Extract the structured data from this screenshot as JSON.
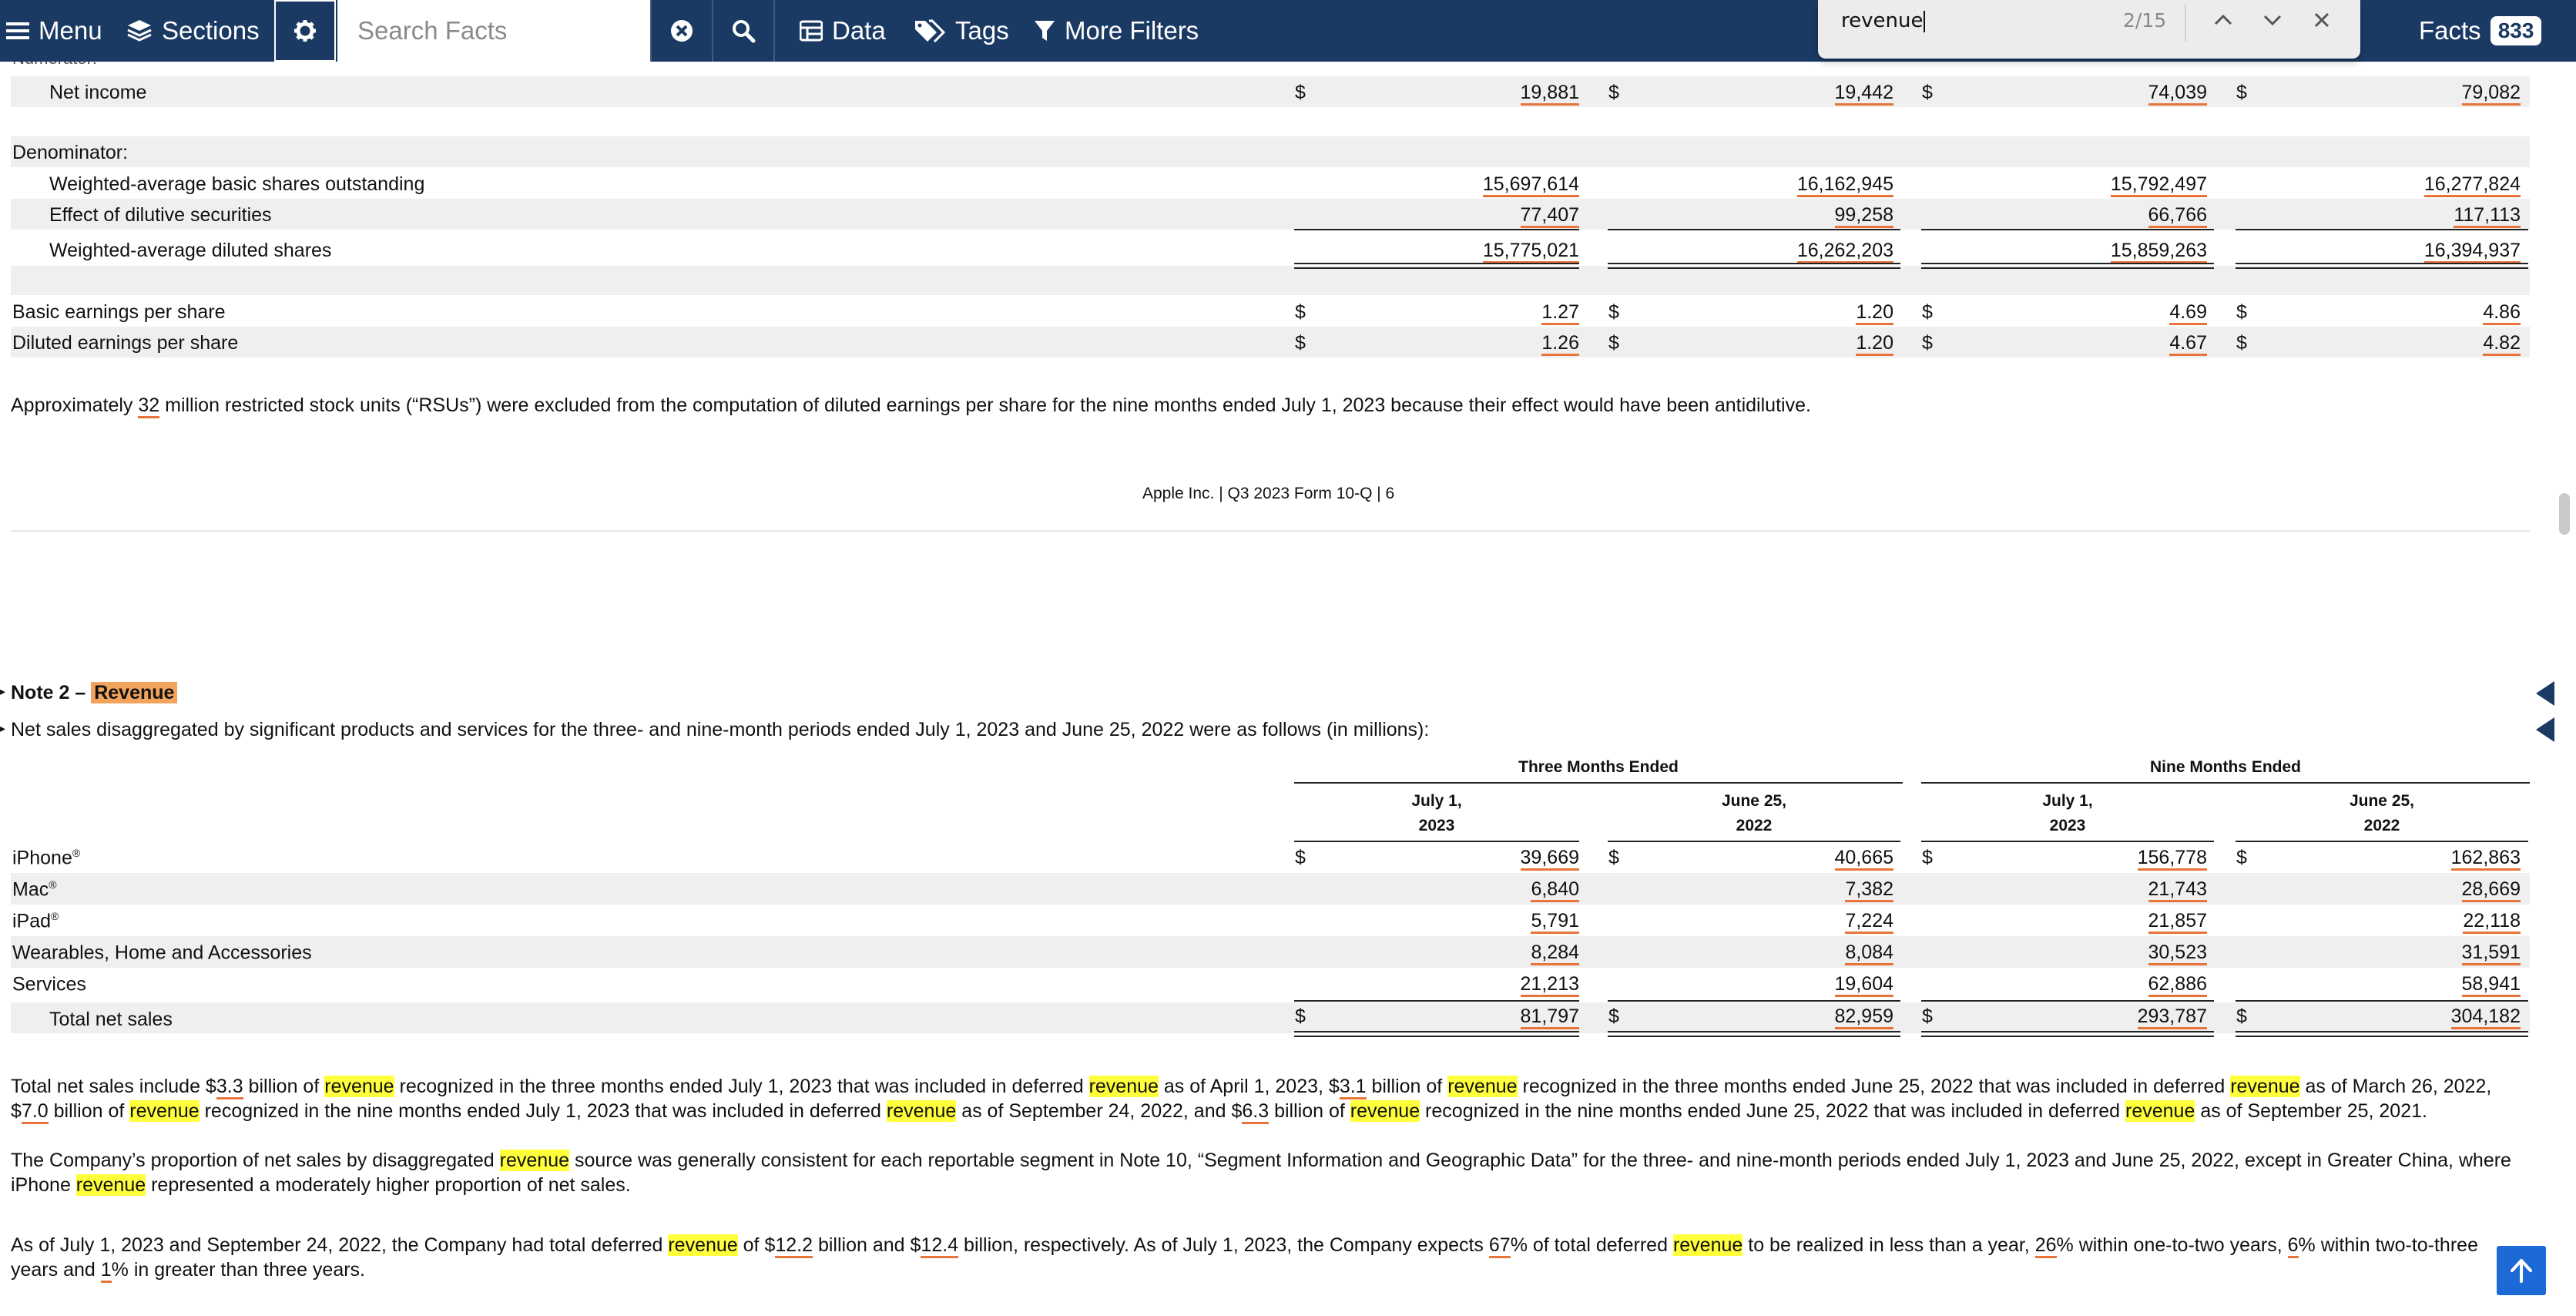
{
  "nav": {
    "menu_label": "Menu",
    "sections_label": "Sections",
    "search_placeholder": "Search Facts",
    "data_label": "Data",
    "tags_label": "Tags",
    "more_filters_label": "More Filters",
    "facts_label": "Facts",
    "facts_count": "833"
  },
  "find": {
    "query": "revenue",
    "count": "2/15"
  },
  "eps": {
    "numerator_label": "Numerator:",
    "net_income": {
      "label": "Net income",
      "values": [
        "19,881",
        "19,442",
        "74,039",
        "79,082"
      ]
    },
    "denominator_label": "Denominator:",
    "basic_shares": {
      "label": "Weighted-average basic shares outstanding",
      "values": [
        "15,697,614",
        "16,162,945",
        "15,792,497",
        "16,277,824"
      ]
    },
    "dilutive": {
      "label": "Effect of dilutive securities",
      "values": [
        "77,407",
        "99,258",
        "66,766",
        "117,113"
      ]
    },
    "diluted_shares": {
      "label": "Weighted-average diluted shares",
      "values": [
        "15,775,021",
        "16,262,203",
        "15,859,263",
        "16,394,937"
      ]
    },
    "basic_eps": {
      "label": "Basic earnings per share",
      "values": [
        "1.27",
        "1.20",
        "4.69",
        "4.86"
      ]
    },
    "diluted_eps": {
      "label": "Diluted earnings per share",
      "values": [
        "1.26",
        "1.20",
        "4.67",
        "4.82"
      ]
    },
    "currency": "$"
  },
  "rsu_note": {
    "pre": "Approximately ",
    "num": "32",
    "post": " million restricted stock units (“RSUs”) were excluded from the computation of diluted earnings per share for the nine months ended July 1, 2023 because their effect would have been antidilutive."
  },
  "page_footer": "Apple Inc. | Q3 2023 Form 10-Q | 6",
  "note2": {
    "title_prefix": "Note 2 – ",
    "title_highlight": "Revenue",
    "intro": "Net sales disaggregated by significant products and services for the three- and nine-month periods ended July 1, 2023 and June 25, 2022 were as follows (in millions):",
    "group_three": "Three Months Ended",
    "group_nine": "Nine Months Ended",
    "col_heads": [
      {
        "line1": "July 1,",
        "line2": "2023"
      },
      {
        "line1": "June 25,",
        "line2": "2022"
      },
      {
        "line1": "July 1,",
        "line2": "2023"
      },
      {
        "line1": "June 25,",
        "line2": "2022"
      }
    ],
    "rows": [
      {
        "label": "iPhone",
        "sup": "®",
        "values": [
          "39,669",
          "40,665",
          "156,778",
          "162,863"
        ]
      },
      {
        "label": "Mac",
        "sup": "®",
        "values": [
          "6,840",
          "7,382",
          "21,743",
          "28,669"
        ]
      },
      {
        "label": "iPad",
        "sup": "®",
        "values": [
          "5,791",
          "7,224",
          "21,857",
          "22,118"
        ]
      },
      {
        "label": "Wearables, Home and Accessories",
        "sup": "",
        "values": [
          "8,284",
          "8,084",
          "30,523",
          "31,591"
        ]
      },
      {
        "label": "Services",
        "sup": "",
        "values": [
          "21,213",
          "19,604",
          "62,886",
          "58,941"
        ]
      }
    ],
    "total": {
      "label": "Total net sales",
      "values": [
        "81,797",
        "82,959",
        "293,787",
        "304,182"
      ]
    }
  },
  "paragraphs": {
    "p1": [
      [
        "t",
        "Total net sales include $"
      ],
      [
        "u",
        "3.3"
      ],
      [
        "t",
        " billion of "
      ],
      [
        "h",
        "revenue"
      ],
      [
        "t",
        " recognized in the three months ended July 1, 2023 that was included in deferred "
      ],
      [
        "h",
        "revenue"
      ],
      [
        "t",
        " as of April 1, 2023, $"
      ],
      [
        "u",
        "3.1"
      ],
      [
        "t",
        " billion of "
      ],
      [
        "h",
        "revenue"
      ],
      [
        "t",
        " recognized in the three months ended June 25, 2022 that was included in deferred "
      ],
      [
        "h",
        "revenue"
      ],
      [
        "t",
        " as of March 26, 2022, $"
      ],
      [
        "u",
        "7.0"
      ],
      [
        "t",
        " billion of "
      ],
      [
        "h",
        "revenue"
      ],
      [
        "t",
        " recognized in the nine months ended July 1, 2023 that was included in deferred "
      ],
      [
        "h",
        "revenue"
      ],
      [
        "t",
        " as of September 24, 2022, and $"
      ],
      [
        "u",
        "6.3"
      ],
      [
        "t",
        " billion of "
      ],
      [
        "h",
        "revenue"
      ],
      [
        "t",
        " recognized in the nine months ended June 25, 2022 that was included in deferred "
      ],
      [
        "h",
        "revenue"
      ],
      [
        "t",
        " as of September 25, 2021."
      ]
    ],
    "p2": [
      [
        "t",
        "The Company’s proportion of net sales by disaggregated "
      ],
      [
        "h",
        "revenue"
      ],
      [
        "t",
        " source was generally consistent for each reportable segment in Note 10, “Segment Information and Geographic Data” for the three- and nine-month periods ended July 1, 2023 and June 25, 2022, except in Greater China, where iPhone "
      ],
      [
        "h",
        "revenue"
      ],
      [
        "t",
        " represented a moderately higher proportion of net sales."
      ]
    ],
    "p3": [
      [
        "t",
        "As of July 1, 2023 and September 24, 2022, the Company had total deferred "
      ],
      [
        "h",
        "revenue"
      ],
      [
        "t",
        " of $"
      ],
      [
        "u",
        "12.2"
      ],
      [
        "t",
        " billion and $"
      ],
      [
        "u",
        "12.4"
      ],
      [
        "t",
        " billion, respectively. As of July 1, 2023, the Company expects "
      ],
      [
        "u",
        "67"
      ],
      [
        "t",
        "% of total deferred "
      ],
      [
        "h",
        "revenue"
      ],
      [
        "t",
        " to be realized in less than a year, "
      ],
      [
        "u",
        "26"
      ],
      [
        "t",
        "% within one-to-two years, "
      ],
      [
        "u",
        "6"
      ],
      [
        "t",
        "% within two-to-three years and "
      ],
      [
        "u",
        "1"
      ],
      [
        "t",
        "% in greater than three years."
      ]
    ]
  }
}
